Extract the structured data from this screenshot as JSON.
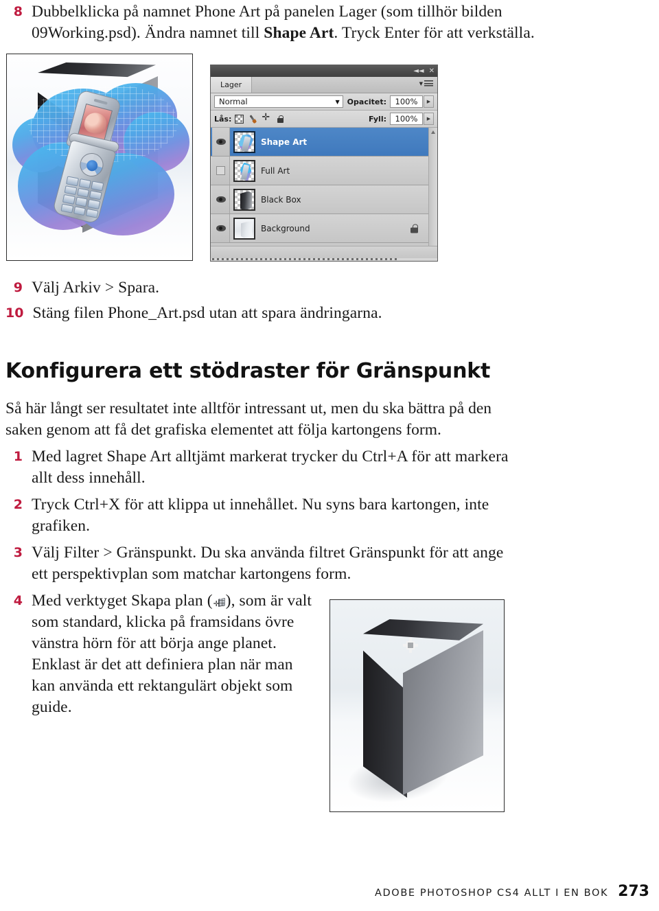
{
  "top_steps": [
    {
      "number": "8",
      "text_before": "Dubbelklicka på namnet Phone Art på panelen Lager (som tillhör bilden 09Working.psd). Ändra namnet till ",
      "bold": "Shape Art",
      "text_after": ". Tryck Enter för att verkställa."
    }
  ],
  "photoshop_panel": {
    "tab_label": "Lager",
    "titlebar": {
      "collapse_icon": "collapse-double-arrow-icon",
      "close_icon": "close-icon"
    },
    "tab_menu_icon": "panel-menu-icon",
    "blend_mode": "Normal",
    "opacity_label": "Opacitet:",
    "opacity_value": "100%",
    "lock_label": "Lås:",
    "lock_icons": [
      "lock-transparent-pixels-icon",
      "lock-image-pixels-icon",
      "lock-position-icon",
      "lock-all-icon"
    ],
    "fill_label": "Fyll:",
    "fill_value": "100%",
    "layers": [
      {
        "name": "Shape Art",
        "visible": true,
        "selected": true,
        "locked": false
      },
      {
        "name": "Full Art",
        "visible": false,
        "selected": false,
        "locked": false
      },
      {
        "name": "Black Box",
        "visible": true,
        "selected": false,
        "locked": false
      },
      {
        "name": "Background",
        "visible": true,
        "selected": false,
        "locked": true
      }
    ]
  },
  "mid_steps": [
    {
      "number": "9",
      "text": "Välj Arkiv > Spara."
    },
    {
      "number": "10",
      "text": "Stäng filen Phone_Art.psd utan att spara ändringarna."
    }
  ],
  "heading": "Konfigurera ett stödraster för Gränspunkt",
  "intro": "Så här långt ser resultatet inte alltför intressant ut, men du ska bättra på den saken genom att få det grafiska elementet att följa kartongens form.",
  "lower_steps": [
    {
      "number": "1",
      "text": "Med lagret Shape Art alltjämt markerat trycker du Ctrl+A för att markera allt dess innehåll."
    },
    {
      "number": "2",
      "text": "Tryck Ctrl+X för att klippa ut innehållet. Nu syns bara kartongen, inte grafiken."
    },
    {
      "number": "3",
      "text": "Välj Filter > Gränspunkt. Du ska använda filtret Gränspunkt för att ange ett perspektivplan som matchar kartongens form."
    },
    {
      "number": "4",
      "text_before": "Med verktyget Skapa plan (",
      "icon": "create-plane-tool-icon",
      "text_after": "), som är valt som standard, klicka på framsidans övre vänstra hörn för att börja ange planet. Enklast är det att definiera plan när man kan använda ett rektangulärt objekt som guide."
    }
  ],
  "figures": {
    "phone_figure_alt": "phone-on-blob-over-carton-figure",
    "box_figure_alt": "black-carton-box-with-vanishing-point-cursor-figure"
  },
  "footer": {
    "title": "ADOBE  PHOTOSHOP  CS4  ALLT  I  EN  BOK",
    "page": "273"
  },
  "colors": {
    "step_number": "#bf1b3f",
    "selected_layer": "#4379bd",
    "panel_bg": "#d6d6d6",
    "text": "#1a1a1a"
  }
}
